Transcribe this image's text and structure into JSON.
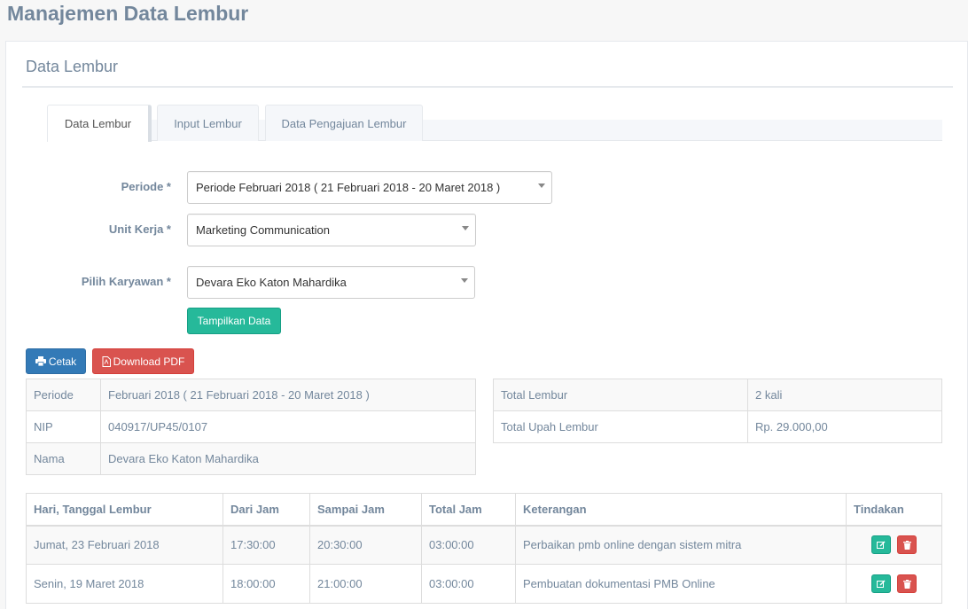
{
  "page": {
    "title": "Manajemen Data Lembur"
  },
  "panel": {
    "title": "Data Lembur"
  },
  "tabs": [
    {
      "label": "Data Lembur",
      "active": true
    },
    {
      "label": "Input Lembur",
      "active": false
    },
    {
      "label": "Data Pengajuan Lembur",
      "active": false
    }
  ],
  "form": {
    "periode": {
      "label": "Periode *",
      "value": "Periode Februari 2018 ( 21 Februari 2018 - 20 Maret 2018 )"
    },
    "unit": {
      "label": "Unit Kerja *",
      "value": "Marketing Communication"
    },
    "karyawan": {
      "label": "Pilih Karyawan *",
      "value": "Devara Eko Katon Mahardika"
    },
    "submit_label": "Tampilkan Data"
  },
  "actions": {
    "print_label": "Cetak",
    "pdf_label": "Download PDF"
  },
  "info_left": [
    {
      "key": "Periode",
      "value": "Februari 2018 ( 21 Februari 2018 - 20 Maret 2018 )"
    },
    {
      "key": "NIP",
      "value": "040917/UP45/0107"
    },
    {
      "key": "Nama",
      "value": "Devara Eko Katon Mahardika"
    }
  ],
  "info_right": [
    {
      "key": "Total Lembur",
      "value": "2 kali"
    },
    {
      "key": "Total Upah Lembur",
      "value": "Rp. 29.000,00"
    }
  ],
  "table": {
    "headers": [
      "Hari, Tanggal Lembur",
      "Dari Jam",
      "Sampai Jam",
      "Total Jam",
      "Keterangan",
      "Tindakan"
    ],
    "rows": [
      [
        "Jumat, 23 Februari 2018",
        "17:30:00",
        "20:30:00",
        "03:00:00",
        "Perbaikan pmb online dengan sistem mitra"
      ],
      [
        "Senin, 19 Maret 2018",
        "18:00:00",
        "21:00:00",
        "03:00:00",
        "Pembuatan dokumentasi PMB Online"
      ]
    ]
  },
  "colors": {
    "success": "#26b99a",
    "primary": "#337ab7",
    "danger": "#d9534f",
    "text": "#73879c"
  },
  "icons": {
    "print": "print-icon",
    "pdf": "file-pdf-icon",
    "edit": "edit-icon",
    "delete": "trash-icon"
  }
}
